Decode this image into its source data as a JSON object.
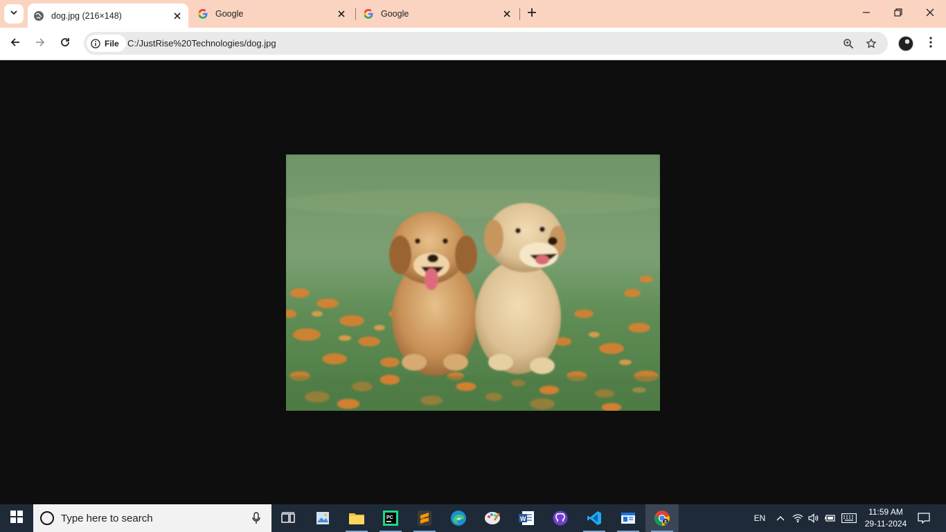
{
  "browser": {
    "tabs": [
      {
        "title": "dog.jpg (216×148)",
        "active": true,
        "favicon": "globe-icon"
      },
      {
        "title": "Google",
        "active": false,
        "favicon": "google-g-icon"
      },
      {
        "title": "Google",
        "active": false,
        "favicon": "google-g-icon"
      }
    ],
    "tabstrip_color": "#fad4c0",
    "omnibox": {
      "chip_label": "File",
      "url": "C:/JustRise%20Technologies/dog.jpg"
    }
  },
  "image": {
    "subject": "two-golden-retriever-puppies-in-flower-field"
  },
  "taskbar": {
    "search_placeholder": "Type here to search",
    "language": "EN",
    "time": "11:59 AM",
    "date": "29-11-2024",
    "apps": [
      "task-view-icon",
      "photos-icon",
      "file-explorer-icon",
      "pycharm-icon",
      "sublime-text-icon",
      "edge-icon",
      "paint-icon",
      "word-icon",
      "github-desktop-icon",
      "vscode-icon",
      "notepad-app-icon",
      "chrome-icon"
    ]
  }
}
